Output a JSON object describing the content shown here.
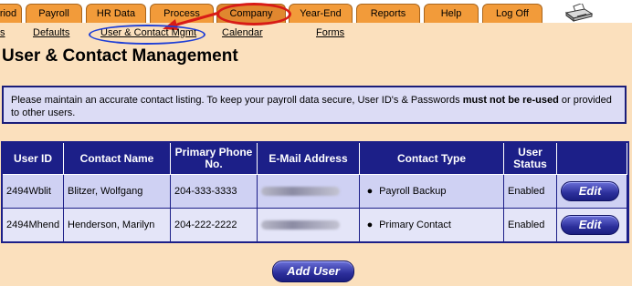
{
  "tabs": [
    {
      "label": "riod",
      "active": false
    },
    {
      "label": "Payroll",
      "active": false
    },
    {
      "label": "HR Data",
      "active": false
    },
    {
      "label": "Process",
      "active": false
    },
    {
      "label": "Company",
      "active": true
    },
    {
      "label": "Year-End",
      "active": false
    },
    {
      "label": "Reports",
      "active": false
    },
    {
      "label": "Help",
      "active": false
    },
    {
      "label": "Log Off",
      "active": false
    }
  ],
  "subnav": [
    {
      "label": "s"
    },
    {
      "label": "Defaults"
    },
    {
      "label": "User & Contact Mgmt"
    },
    {
      "label": "Calendar"
    },
    {
      "label": "Forms"
    }
  ],
  "page_title": "User & Contact Management",
  "info": {
    "text_before": "Please maintain an accurate contact listing. To keep your payroll data secure, User ID's & Passwords ",
    "text_bold": "must not be re-used",
    "text_after": " or provided to other users."
  },
  "table": {
    "headers": [
      "User ID",
      "Contact Name",
      "Primary Phone No.",
      "E-Mail Address",
      "Contact Type",
      "User Status",
      ""
    ],
    "rows": [
      {
        "user_id": "2494Wblit",
        "name": "Blitzer, Wolfgang",
        "phone": "204-333-3333",
        "contact_type": "Payroll Backup",
        "status": "Enabled",
        "action": "Edit"
      },
      {
        "user_id": "2494Mhend",
        "name": "Henderson, Marilyn",
        "phone": "204-222-2222",
        "contact_type": "Primary Contact",
        "status": "Enabled",
        "action": "Edit"
      }
    ]
  },
  "add_user_label": "Add User",
  "icons": {
    "printer": "printer-icon",
    "bullet": "bullet-icon"
  },
  "colors": {
    "tab": "#f29b3a",
    "header": "#1c1f88",
    "background": "#fbe0bd",
    "annotation_red": "#d81b16",
    "annotation_blue": "#1f3fd6"
  }
}
